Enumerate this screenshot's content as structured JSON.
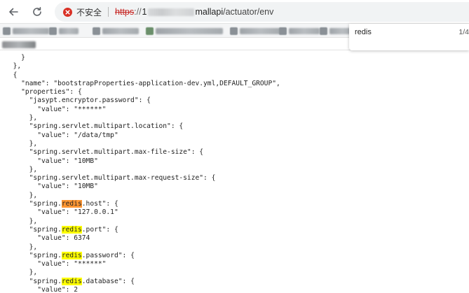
{
  "toolbar": {
    "security_label": "不安全",
    "url": {
      "scheme": "https",
      "separator": "://",
      "host_start": "1",
      "host_end": "mallapi",
      "path": "/actuator/env"
    }
  },
  "find_bar": {
    "query": "redis",
    "count": "1/4"
  },
  "json_lines": [
    {
      "indent": 2,
      "parts": [
        {
          "t": "}"
        }
      ]
    },
    {
      "indent": 1,
      "parts": [
        {
          "t": "},"
        }
      ]
    },
    {
      "indent": 1,
      "parts": [
        {
          "t": "{"
        }
      ]
    },
    {
      "indent": 2,
      "parts": [
        {
          "t": "\"name\": \"bootstrapProperties-application-dev.yml,DEFAULT_GROUP\","
        }
      ]
    },
    {
      "indent": 2,
      "parts": [
        {
          "t": "\"properties\": {"
        }
      ]
    },
    {
      "indent": 3,
      "parts": [
        {
          "t": "\"jasypt.encryptor.password\": {"
        }
      ]
    },
    {
      "indent": 4,
      "parts": [
        {
          "t": "\"value\": \"******\""
        }
      ]
    },
    {
      "indent": 3,
      "parts": [
        {
          "t": "},"
        }
      ]
    },
    {
      "indent": 3,
      "parts": [
        {
          "t": "\"spring.servlet.multipart.location\": {"
        }
      ]
    },
    {
      "indent": 4,
      "parts": [
        {
          "t": "\"value\": \"/data/tmp\""
        }
      ]
    },
    {
      "indent": 3,
      "parts": [
        {
          "t": "},"
        }
      ]
    },
    {
      "indent": 3,
      "parts": [
        {
          "t": "\"spring.servlet.multipart.max-file-size\": {"
        }
      ]
    },
    {
      "indent": 4,
      "parts": [
        {
          "t": "\"value\": \"10MB\""
        }
      ]
    },
    {
      "indent": 3,
      "parts": [
        {
          "t": "},"
        }
      ]
    },
    {
      "indent": 3,
      "parts": [
        {
          "t": "\"spring.servlet.multipart.max-request-size\": {"
        }
      ]
    },
    {
      "indent": 4,
      "parts": [
        {
          "t": "\"value\": \"10MB\""
        }
      ]
    },
    {
      "indent": 3,
      "parts": [
        {
          "t": "},"
        }
      ]
    },
    {
      "indent": 3,
      "parts": [
        {
          "t": "\"spring."
        },
        {
          "t": "redis",
          "hl": "current"
        },
        {
          "t": ".host\": {"
        }
      ]
    },
    {
      "indent": 4,
      "parts": [
        {
          "t": "\"value\": \"127.0.0.1\""
        }
      ]
    },
    {
      "indent": 3,
      "parts": [
        {
          "t": "},"
        }
      ]
    },
    {
      "indent": 3,
      "parts": [
        {
          "t": "\"spring."
        },
        {
          "t": "redis",
          "hl": "match"
        },
        {
          "t": ".port\": {"
        }
      ]
    },
    {
      "indent": 4,
      "parts": [
        {
          "t": "\"value\": 6374"
        }
      ]
    },
    {
      "indent": 3,
      "parts": [
        {
          "t": "},"
        }
      ]
    },
    {
      "indent": 3,
      "parts": [
        {
          "t": "\"spring."
        },
        {
          "t": "redis",
          "hl": "match"
        },
        {
          "t": ".password\": {"
        }
      ]
    },
    {
      "indent": 4,
      "parts": [
        {
          "t": "\"value\": \"******\""
        }
      ]
    },
    {
      "indent": 3,
      "parts": [
        {
          "t": "},"
        }
      ]
    },
    {
      "indent": 3,
      "parts": [
        {
          "t": "\"spring."
        },
        {
          "t": "redis",
          "hl": "match"
        },
        {
          "t": ".database\": {"
        }
      ]
    },
    {
      "indent": 4,
      "parts": [
        {
          "t": "\"value\": 2"
        }
      ]
    }
  ],
  "colors": {
    "current_match": "#ff9632",
    "match": "#ffff00",
    "insecure": "#c5221f"
  }
}
